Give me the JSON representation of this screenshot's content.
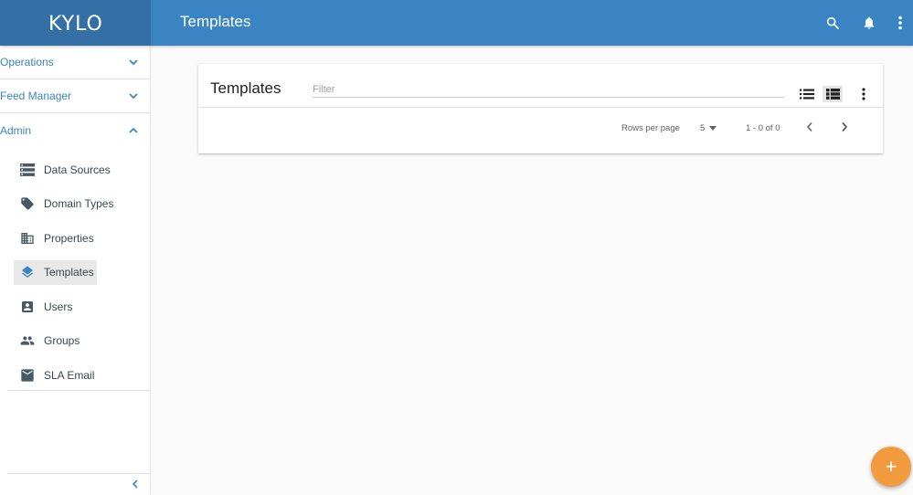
{
  "app": {
    "logo": "KYLO",
    "page_title": "Templates"
  },
  "colors": {
    "primary": "#3b84c3",
    "primary_dark": "#3470a5",
    "accent": "#f29a3e"
  },
  "topbar_icons": [
    "search-icon",
    "bell-icon",
    "more-vert-icon"
  ],
  "sidebar": {
    "sections": [
      {
        "label": "Operations",
        "expanded": false
      },
      {
        "label": "Feed Manager",
        "expanded": false
      },
      {
        "label": "Admin",
        "expanded": true
      }
    ],
    "admin_items": [
      {
        "label": "Data Sources",
        "icon": "storage-icon"
      },
      {
        "label": "Domain Types",
        "icon": "label-icon"
      },
      {
        "label": "Properties",
        "icon": "business-icon"
      },
      {
        "label": "Templates",
        "icon": "layers-icon",
        "active": true
      },
      {
        "label": "Users",
        "icon": "account-box-icon"
      },
      {
        "label": "Groups",
        "icon": "people-icon"
      },
      {
        "label": "SLA Email",
        "icon": "email-icon"
      }
    ]
  },
  "card": {
    "title": "Templates",
    "filter_placeholder": "Filter",
    "pagination": {
      "rows_per_page_label": "Rows per page",
      "rows_per_page_value": "5",
      "range": "1 - 0 of 0"
    }
  },
  "fab": {
    "label": "+"
  }
}
